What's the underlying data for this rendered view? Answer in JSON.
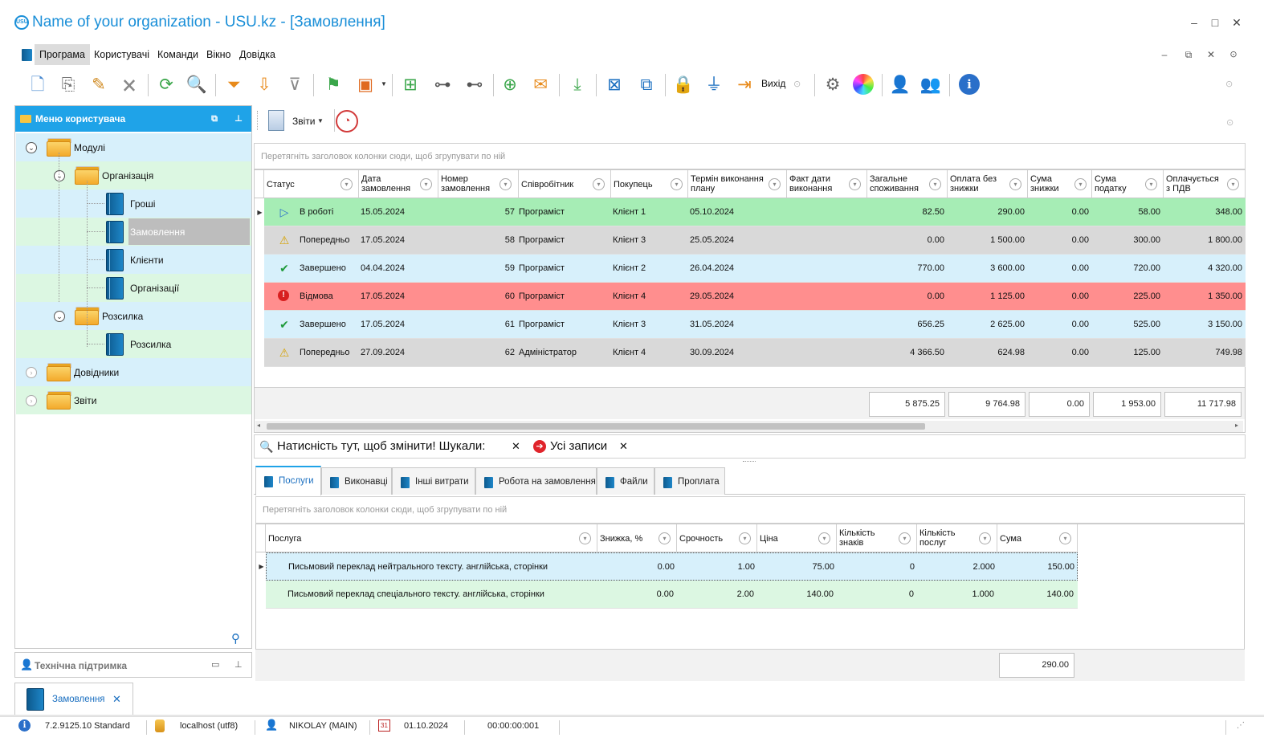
{
  "window": {
    "title": "Name of your organization - USU.kz - [Замовлення]",
    "logo_text": "USU",
    "minimize": "–",
    "maximize": "□",
    "close": "✕"
  },
  "menu": {
    "items": [
      "Програма",
      "Користувачі",
      "Команди",
      "Вікно",
      "Довідка"
    ],
    "active": "Програма"
  },
  "toolbar": {
    "exit_label": "Вихід"
  },
  "left_panel": {
    "title": "Меню користувача",
    "tree": [
      {
        "label": "Модулі"
      },
      {
        "label": "Організація"
      },
      {
        "label": "Гроші"
      },
      {
        "label": "Замовлення"
      },
      {
        "label": "Клієнти"
      },
      {
        "label": "Організації"
      },
      {
        "label": "Розсилка"
      },
      {
        "label": "Розсилка"
      },
      {
        "label": "Довідники"
      },
      {
        "label": "Звіти"
      }
    ],
    "selected": "Замовлення"
  },
  "support_panel": {
    "title": "Технічна підтримка"
  },
  "reports": {
    "label": "Звіти"
  },
  "orders_grid": {
    "group_hint": "Перетягніть заголовок колонки сюди, щоб згрупувати по ній",
    "columns": [
      "Статус",
      "Дата замовлення",
      "Номер замовлення",
      "Співробітник",
      "Покупець",
      "Термін виконання плану",
      "Факт дати виконання",
      "Загальне споживання",
      "Оплата без знижки",
      "Сума знижки",
      "Сума податку",
      "Оплачується з ПДВ"
    ],
    "rows": [
      {
        "status": "В роботі",
        "date": "15.05.2024",
        "num": "57",
        "employee": "Програміст",
        "client": "Клієнт 1",
        "plan": "05.10.2024",
        "fact": "",
        "consumption": "82.50",
        "no_discount": "290.00",
        "discount": "0.00",
        "tax": "58.00",
        "with_vat": "348.00"
      },
      {
        "status": "Попередньо",
        "date": "17.05.2024",
        "num": "58",
        "employee": "Програміст",
        "client": "Клієнт 3",
        "plan": "25.05.2024",
        "fact": "",
        "consumption": "0.00",
        "no_discount": "1 500.00",
        "discount": "0.00",
        "tax": "300.00",
        "with_vat": "1 800.00"
      },
      {
        "status": "Завершено",
        "date": "04.04.2024",
        "num": "59",
        "employee": "Програміст",
        "client": "Клієнт 2",
        "plan": "26.04.2024",
        "fact": "",
        "consumption": "770.00",
        "no_discount": "3 600.00",
        "discount": "0.00",
        "tax": "720.00",
        "with_vat": "4 320.00"
      },
      {
        "status": "Відмова",
        "date": "17.05.2024",
        "num": "60",
        "employee": "Програміст",
        "client": "Клієнт 4",
        "plan": "29.05.2024",
        "fact": "",
        "consumption": "0.00",
        "no_discount": "1 125.00",
        "discount": "0.00",
        "tax": "225.00",
        "with_vat": "1 350.00"
      },
      {
        "status": "Завершено",
        "date": "17.05.2024",
        "num": "61",
        "employee": "Програміст",
        "client": "Клієнт 3",
        "plan": "31.05.2024",
        "fact": "",
        "consumption": "656.25",
        "no_discount": "2 625.00",
        "discount": "0.00",
        "tax": "525.00",
        "with_vat": "3 150.00"
      },
      {
        "status": "Попередньо",
        "date": "27.09.2024",
        "num": "62",
        "employee": "Адміністратор",
        "client": "Клієнт 4",
        "plan": "30.09.2024",
        "fact": "",
        "consumption": "4 366.50",
        "no_discount": "624.98",
        "discount": "0.00",
        "tax": "125.00",
        "with_vat": "749.98"
      }
    ],
    "totals": {
      "consumption": "5 875.25",
      "no_discount": "9 764.98",
      "discount": "0.00",
      "tax": "1 953.00",
      "with_vat": "11 717.98"
    },
    "row_colors": {
      "in_work": "#a6edb5",
      "preliminary": "#d9d9d9",
      "done": "#d7f0fb",
      "refused": "#ff8e8e"
    }
  },
  "filter_bar": {
    "search_text": "Натисність тут, щоб змінити! Шукали:",
    "records_text": "Усі записи"
  },
  "detail_tabs": [
    "Послуги",
    "Виконавці",
    "Інші витрати",
    "Робота на замовлення",
    "Файли",
    "Проплата"
  ],
  "services_grid": {
    "group_hint": "Перетягніть заголовок колонки сюди, щоб згрупувати по ній",
    "columns": [
      "Послуга",
      "Знижка, %",
      "Срочность",
      "Ціна",
      "Кількість знаків",
      "Кількість послуг",
      "Сума"
    ],
    "rows": [
      {
        "service": "Письмовий переклад нейтрального тексту. англійська, сторінки",
        "discount": "0.00",
        "urgency": "1.00",
        "price": "75.00",
        "chars": "0",
        "count": "2.000",
        "sum": "150.00"
      },
      {
        "service": "Письмовий переклад спеціального тексту. англійська, сторінки",
        "discount": "0.00",
        "urgency": "2.00",
        "price": "140.00",
        "chars": "0",
        "count": "1.000",
        "sum": "140.00"
      }
    ],
    "total": "290.00"
  },
  "doc_tab": {
    "label": "Замовлення"
  },
  "status_bar": {
    "version": "7.2.9125.10 Standard",
    "db": "localhost (utf8)",
    "user": "NIKOLAY (MAIN)",
    "calendar_day": "31",
    "date": "01.10.2024",
    "timer": "00:00:00:001"
  }
}
